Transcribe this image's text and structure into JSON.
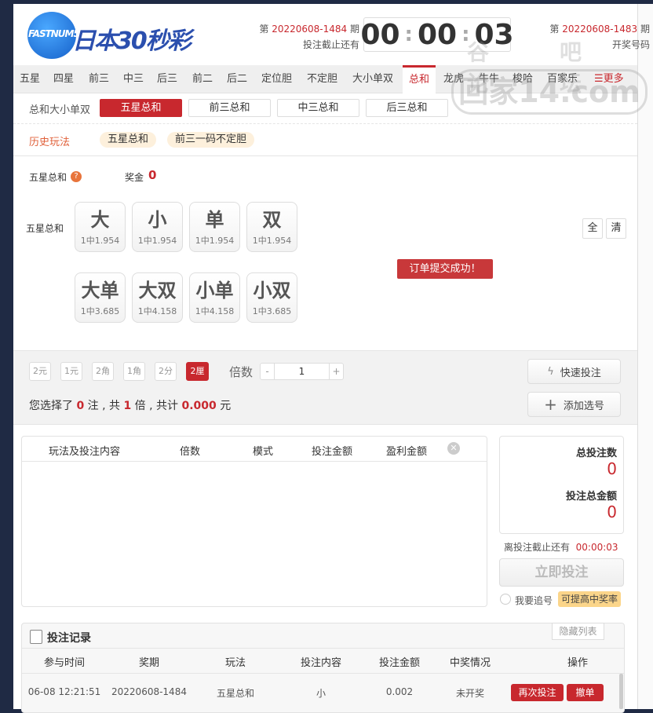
{
  "header": {
    "logo_text": "FASTNUM5",
    "title": "日本30秒彩",
    "current_issue_prefix": "第",
    "current_issue": "20220608-1484",
    "current_issue_suffix": "期",
    "deadline_label": "投注截止还有",
    "countdown": {
      "h": "00",
      "m": "00",
      "s": "03"
    },
    "last_issue_prefix": "第",
    "last_issue": "20220608-1483",
    "last_issue_suffix": "期",
    "draw_label": "开奖号码"
  },
  "nav": {
    "items": [
      "五星",
      "四星",
      "前三",
      "中三",
      "后三",
      "前二",
      "后二",
      "定位胆",
      "不定胆",
      "大小单双",
      "总和",
      "龙虎",
      "牛牛",
      "梭哈",
      "百家乐"
    ],
    "active": "总和",
    "more": "更多"
  },
  "subnav": {
    "label": "总和大小单双",
    "buttons": [
      "五星总和",
      "前三总和",
      "中三总和",
      "后三总和"
    ],
    "active": "五星总和"
  },
  "history": {
    "label": "历史玩法",
    "chips": [
      "五星总和",
      "前三一码不定胆"
    ]
  },
  "play": {
    "title": "五星总和",
    "help": "?",
    "prize_label": "奖金",
    "prize": "0",
    "row_label": "五星总和",
    "balls": [
      {
        "t": "大",
        "o": "1中1.954"
      },
      {
        "t": "小",
        "o": "1中1.954"
      },
      {
        "t": "单",
        "o": "1中1.954"
      },
      {
        "t": "双",
        "o": "1中1.954"
      },
      {
        "t": "大单",
        "o": "1中3.685"
      },
      {
        "t": "大双",
        "o": "1中4.158"
      },
      {
        "t": "小单",
        "o": "1中4.158"
      },
      {
        "t": "小双",
        "o": "1中3.685"
      }
    ],
    "all": "全",
    "clear": "清"
  },
  "toast": "订单提交成功！",
  "modes": {
    "items": [
      "2元",
      "1元",
      "2角",
      "1角",
      "2分",
      "2厘"
    ],
    "active": "2厘"
  },
  "multiplier": {
    "label": "倍数",
    "minus": "-",
    "value": "1",
    "plus": "+"
  },
  "quick_bet": "快速投注",
  "add_selection": "添加选号",
  "summary": {
    "p1": "您选择了",
    "count": "0",
    "p2": "注 , 共",
    "times": "1",
    "p3": "倍 , 共计",
    "amount": "0.000",
    "p4": "元"
  },
  "cart": {
    "headers": [
      "玩法及投注内容",
      "倍数",
      "模式",
      "投注金额",
      "盈利金额"
    ]
  },
  "totals": {
    "count_label": "总投注数",
    "count": "0",
    "amount_label": "投注总金额",
    "amount": "0"
  },
  "deadline2_label": "离投注截止还有",
  "deadline2": "00:00:03",
  "bet_now": "立即投注",
  "chase_label": "我要追号",
  "chase_tip": "可提高中奖率",
  "records": {
    "title": "投注记录",
    "hide": "隐藏列表",
    "headers": [
      "参与时间",
      "奖期",
      "玩法",
      "投注内容",
      "投注金额",
      "中奖情况",
      "操作"
    ],
    "rows": [
      {
        "time": "06-08 12:21:51",
        "issue": "20220608-1484",
        "play": "五星总和",
        "content": "小",
        "amount": "0.002",
        "status": "未开奖",
        "rebet": "再次投注",
        "cancel": "撤单"
      }
    ]
  },
  "watermark": {
    "top": "谷吧 论坛",
    "main": "回家14.com"
  },
  "colors": {
    "accent": "#c8282e",
    "sidebar": "#1f2a44"
  }
}
